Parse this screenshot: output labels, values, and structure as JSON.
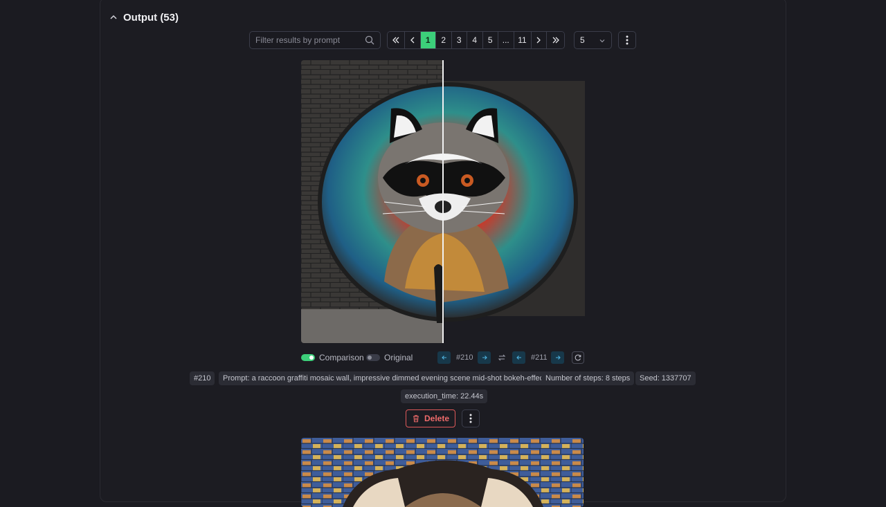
{
  "section": {
    "title": "Output (53)"
  },
  "search": {
    "placeholder": "Filter results by prompt"
  },
  "pagination": {
    "pages": [
      "1",
      "2",
      "3",
      "4",
      "5",
      "...",
      "11"
    ],
    "current": "1"
  },
  "per_page": {
    "value": "5"
  },
  "result": {
    "comparison_label": "Comparison",
    "original_label": "Original",
    "left_id": "#210",
    "right_id": "#211",
    "tags": {
      "id": "#210",
      "prompt": "Prompt: a raccoon graffiti mosaic wall, impressive dimmed evening scene mid-shot bokeh-effect",
      "steps": "Number of steps: 8 steps",
      "seed": "Seed: 1337707",
      "execution_time": "execution_time: 22.44s"
    },
    "delete_label": "Delete"
  },
  "colors": {
    "accent": "#3ccf7a",
    "danger": "#e05a5a",
    "background": "#1b1b21"
  }
}
